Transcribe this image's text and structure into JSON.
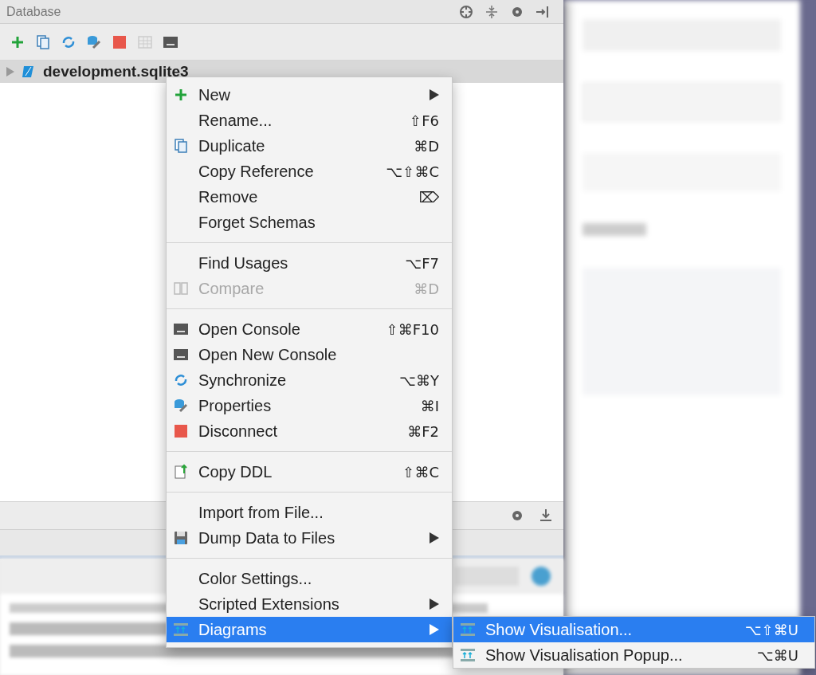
{
  "panel": {
    "title": "Database"
  },
  "tree": {
    "items": [
      {
        "label": "development.sqlite3",
        "expanded": false
      }
    ]
  },
  "context_menu": {
    "items": [
      {
        "kind": "item",
        "label": "New",
        "submenu": true,
        "disabled": false,
        "selected": false
      },
      {
        "kind": "item",
        "label": "Rename...",
        "shortcut": "⇧F6",
        "disabled": false,
        "selected": false
      },
      {
        "kind": "item",
        "label": "Duplicate",
        "shortcut": "⌘D",
        "disabled": false,
        "selected": false
      },
      {
        "kind": "item",
        "label": "Copy Reference",
        "shortcut": "⌥⇧⌘C",
        "disabled": false,
        "selected": false
      },
      {
        "kind": "item",
        "label": "Remove",
        "shortcut": "⌦",
        "disabled": false,
        "selected": false
      },
      {
        "kind": "item",
        "label": "Forget Schemas",
        "disabled": false,
        "selected": false
      },
      {
        "kind": "separator"
      },
      {
        "kind": "item",
        "label": "Find Usages",
        "shortcut": "⌥F7",
        "disabled": false,
        "selected": false
      },
      {
        "kind": "item",
        "label": "Compare",
        "shortcut": "⌘D",
        "disabled": true,
        "selected": false
      },
      {
        "kind": "separator"
      },
      {
        "kind": "item",
        "label": "Open Console",
        "shortcut": "⇧⌘F10",
        "disabled": false,
        "selected": false
      },
      {
        "kind": "item",
        "label": "Open New Console",
        "disabled": false,
        "selected": false
      },
      {
        "kind": "item",
        "label": "Synchronize",
        "shortcut": "⌥⌘Y",
        "disabled": false,
        "selected": false
      },
      {
        "kind": "item",
        "label": "Properties",
        "shortcut": "⌘I",
        "disabled": false,
        "selected": false
      },
      {
        "kind": "item",
        "label": "Disconnect",
        "shortcut": "⌘F2",
        "disabled": false,
        "selected": false
      },
      {
        "kind": "separator"
      },
      {
        "kind": "item",
        "label": "Copy DDL",
        "shortcut": "⇧⌘C",
        "disabled": false,
        "selected": false
      },
      {
        "kind": "separator"
      },
      {
        "kind": "item",
        "label": "Import from File...",
        "disabled": false,
        "selected": false
      },
      {
        "kind": "item",
        "label": "Dump Data to Files",
        "submenu": true,
        "disabled": false,
        "selected": false
      },
      {
        "kind": "separator"
      },
      {
        "kind": "item",
        "label": "Color Settings...",
        "disabled": false,
        "selected": false
      },
      {
        "kind": "item",
        "label": "Scripted Extensions",
        "submenu": true,
        "disabled": false,
        "selected": false
      },
      {
        "kind": "item",
        "label": "Diagrams",
        "submenu": true,
        "disabled": false,
        "selected": true
      }
    ]
  },
  "submenu": {
    "items": [
      {
        "label": "Show Visualisation...",
        "shortcut": "⌥⇧⌘U",
        "selected": true
      },
      {
        "label": "Show Visualisation Popup...",
        "shortcut": "⌥⌘U",
        "selected": false
      }
    ]
  }
}
